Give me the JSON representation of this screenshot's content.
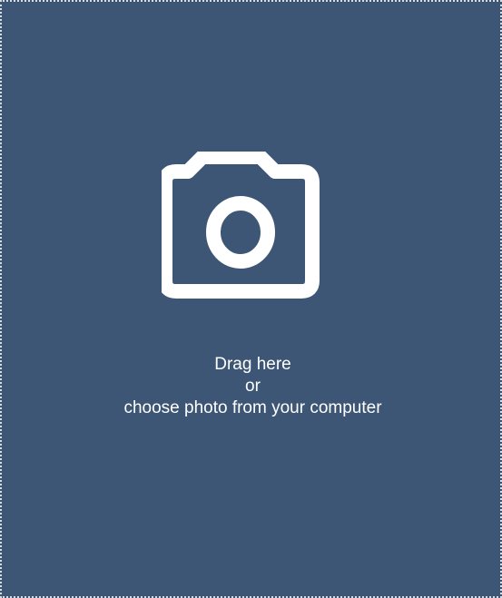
{
  "upload": {
    "icon": "camera-icon",
    "line1": "Drag here",
    "line2": "or",
    "line3": "choose photo from your computer",
    "background_color": "#3d5675",
    "text_color": "#ffffff"
  }
}
